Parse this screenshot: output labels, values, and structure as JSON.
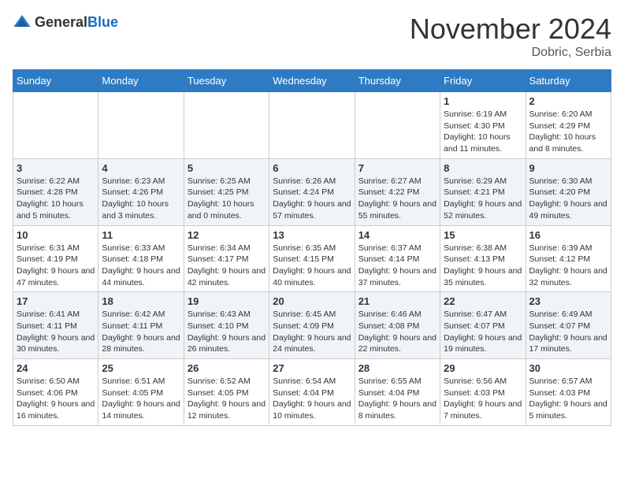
{
  "header": {
    "logo": {
      "general": "General",
      "blue": "Blue"
    },
    "month": "November 2024",
    "location": "Dobric, Serbia"
  },
  "weekdays": [
    "Sunday",
    "Monday",
    "Tuesday",
    "Wednesday",
    "Thursday",
    "Friday",
    "Saturday"
  ],
  "weeks": [
    [
      {
        "day": "",
        "info": ""
      },
      {
        "day": "",
        "info": ""
      },
      {
        "day": "",
        "info": ""
      },
      {
        "day": "",
        "info": ""
      },
      {
        "day": "",
        "info": ""
      },
      {
        "day": "1",
        "info": "Sunrise: 6:19 AM\nSunset: 4:30 PM\nDaylight: 10 hours and 11 minutes."
      },
      {
        "day": "2",
        "info": "Sunrise: 6:20 AM\nSunset: 4:29 PM\nDaylight: 10 hours and 8 minutes."
      }
    ],
    [
      {
        "day": "3",
        "info": "Sunrise: 6:22 AM\nSunset: 4:28 PM\nDaylight: 10 hours and 5 minutes."
      },
      {
        "day": "4",
        "info": "Sunrise: 6:23 AM\nSunset: 4:26 PM\nDaylight: 10 hours and 3 minutes."
      },
      {
        "day": "5",
        "info": "Sunrise: 6:25 AM\nSunset: 4:25 PM\nDaylight: 10 hours and 0 minutes."
      },
      {
        "day": "6",
        "info": "Sunrise: 6:26 AM\nSunset: 4:24 PM\nDaylight: 9 hours and 57 minutes."
      },
      {
        "day": "7",
        "info": "Sunrise: 6:27 AM\nSunset: 4:22 PM\nDaylight: 9 hours and 55 minutes."
      },
      {
        "day": "8",
        "info": "Sunrise: 6:29 AM\nSunset: 4:21 PM\nDaylight: 9 hours and 52 minutes."
      },
      {
        "day": "9",
        "info": "Sunrise: 6:30 AM\nSunset: 4:20 PM\nDaylight: 9 hours and 49 minutes."
      }
    ],
    [
      {
        "day": "10",
        "info": "Sunrise: 6:31 AM\nSunset: 4:19 PM\nDaylight: 9 hours and 47 minutes."
      },
      {
        "day": "11",
        "info": "Sunrise: 6:33 AM\nSunset: 4:18 PM\nDaylight: 9 hours and 44 minutes."
      },
      {
        "day": "12",
        "info": "Sunrise: 6:34 AM\nSunset: 4:17 PM\nDaylight: 9 hours and 42 minutes."
      },
      {
        "day": "13",
        "info": "Sunrise: 6:35 AM\nSunset: 4:15 PM\nDaylight: 9 hours and 40 minutes."
      },
      {
        "day": "14",
        "info": "Sunrise: 6:37 AM\nSunset: 4:14 PM\nDaylight: 9 hours and 37 minutes."
      },
      {
        "day": "15",
        "info": "Sunrise: 6:38 AM\nSunset: 4:13 PM\nDaylight: 9 hours and 35 minutes."
      },
      {
        "day": "16",
        "info": "Sunrise: 6:39 AM\nSunset: 4:12 PM\nDaylight: 9 hours and 32 minutes."
      }
    ],
    [
      {
        "day": "17",
        "info": "Sunrise: 6:41 AM\nSunset: 4:11 PM\nDaylight: 9 hours and 30 minutes."
      },
      {
        "day": "18",
        "info": "Sunrise: 6:42 AM\nSunset: 4:11 PM\nDaylight: 9 hours and 28 minutes."
      },
      {
        "day": "19",
        "info": "Sunrise: 6:43 AM\nSunset: 4:10 PM\nDaylight: 9 hours and 26 minutes."
      },
      {
        "day": "20",
        "info": "Sunrise: 6:45 AM\nSunset: 4:09 PM\nDaylight: 9 hours and 24 minutes."
      },
      {
        "day": "21",
        "info": "Sunrise: 6:46 AM\nSunset: 4:08 PM\nDaylight: 9 hours and 22 minutes."
      },
      {
        "day": "22",
        "info": "Sunrise: 6:47 AM\nSunset: 4:07 PM\nDaylight: 9 hours and 19 minutes."
      },
      {
        "day": "23",
        "info": "Sunrise: 6:49 AM\nSunset: 4:07 PM\nDaylight: 9 hours and 17 minutes."
      }
    ],
    [
      {
        "day": "24",
        "info": "Sunrise: 6:50 AM\nSunset: 4:06 PM\nDaylight: 9 hours and 16 minutes."
      },
      {
        "day": "25",
        "info": "Sunrise: 6:51 AM\nSunset: 4:05 PM\nDaylight: 9 hours and 14 minutes."
      },
      {
        "day": "26",
        "info": "Sunrise: 6:52 AM\nSunset: 4:05 PM\nDaylight: 9 hours and 12 minutes."
      },
      {
        "day": "27",
        "info": "Sunrise: 6:54 AM\nSunset: 4:04 PM\nDaylight: 9 hours and 10 minutes."
      },
      {
        "day": "28",
        "info": "Sunrise: 6:55 AM\nSunset: 4:04 PM\nDaylight: 9 hours and 8 minutes."
      },
      {
        "day": "29",
        "info": "Sunrise: 6:56 AM\nSunset: 4:03 PM\nDaylight: 9 hours and 7 minutes."
      },
      {
        "day": "30",
        "info": "Sunrise: 6:57 AM\nSunset: 4:03 PM\nDaylight: 9 hours and 5 minutes."
      }
    ]
  ]
}
